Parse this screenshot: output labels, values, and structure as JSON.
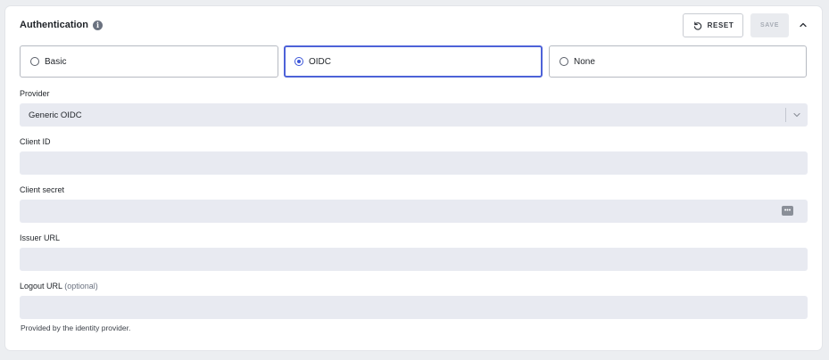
{
  "section": {
    "title": "Authentication",
    "info_icon": "info-icon",
    "reset_label": "RESET",
    "save_label": "SAVE",
    "collapse_icon": "chevron-up-icon"
  },
  "auth_options": [
    {
      "label": "Basic",
      "selected": false
    },
    {
      "label": "OIDC",
      "selected": true
    },
    {
      "label": "None",
      "selected": false
    }
  ],
  "fields": {
    "provider": {
      "label": "Provider",
      "value": "Generic OIDC"
    },
    "client_id": {
      "label": "Client ID",
      "value": ""
    },
    "client_secret": {
      "label": "Client secret",
      "value": "",
      "icon": "password-dots-icon",
      "icon_text": "•••"
    },
    "issuer_url": {
      "label": "Issuer URL",
      "value": ""
    },
    "logout_url": {
      "label": "Logout URL",
      "optional_tag": "(optional)",
      "value": "",
      "help": "Provided by the identity provider."
    }
  },
  "colors": {
    "accent": "#4d62d8",
    "field_bg": "#e8eaf1",
    "page_bg": "#eceef1"
  }
}
